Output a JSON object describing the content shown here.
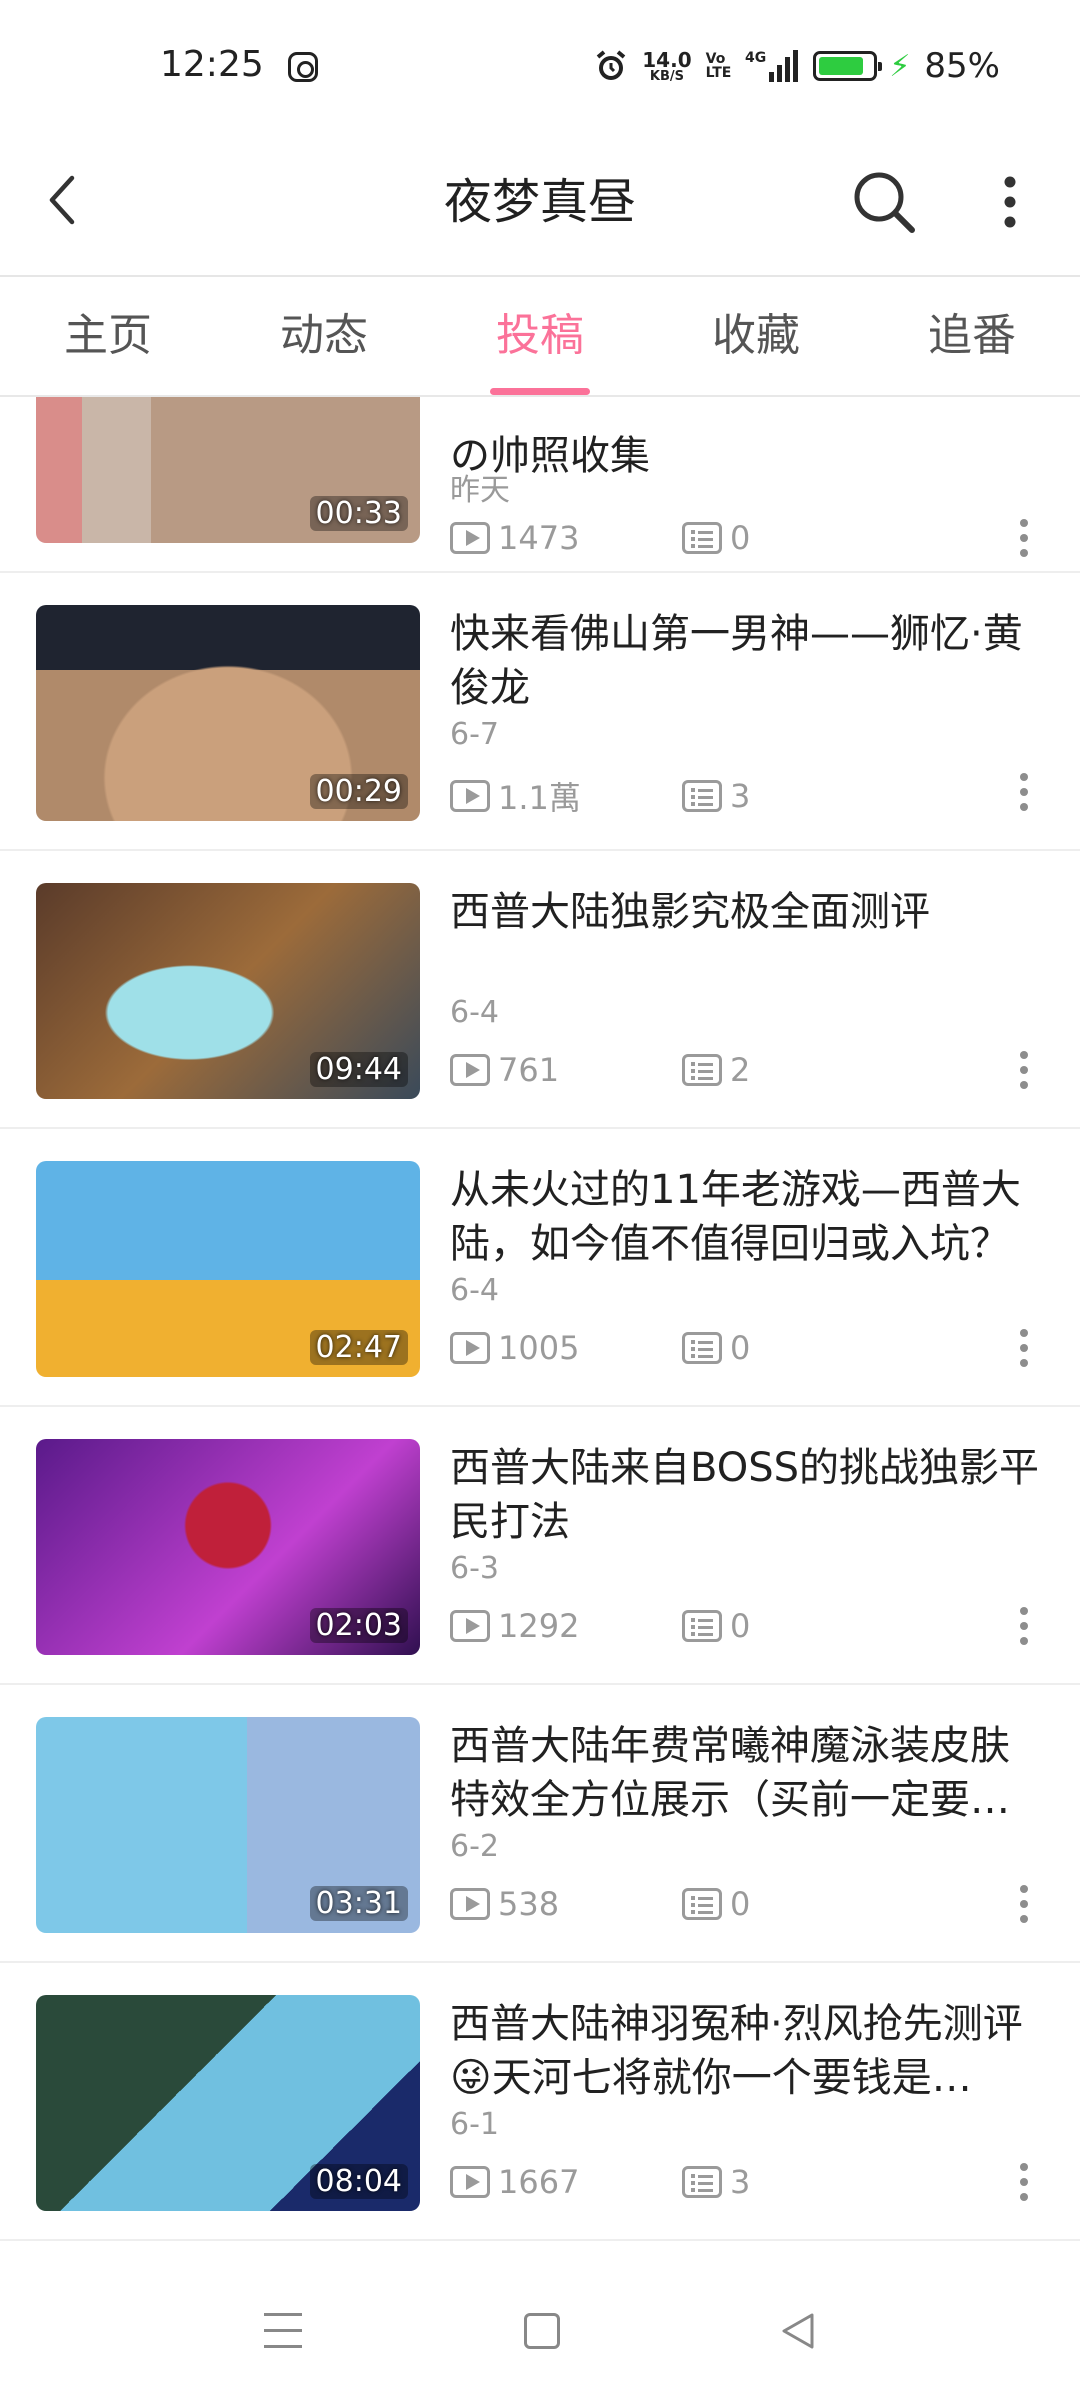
{
  "status_bar": {
    "time": "12:25",
    "net_speed_value": "14.0",
    "net_speed_unit": "KB/S",
    "volte_top": "Vo",
    "volte_bottom": "LTE",
    "network": "4G",
    "battery_level": 0.85,
    "battery_text": "85%",
    "battery_color": "#2ecc40"
  },
  "toolbar": {
    "title": "夜梦真昼"
  },
  "tabs": [
    {
      "label": "主页"
    },
    {
      "label": "动态"
    },
    {
      "label": "投稿",
      "active": true
    },
    {
      "label": "收藏"
    },
    {
      "label": "追番"
    }
  ],
  "accent_color": "#fb7299",
  "videos": [
    {
      "title": "の帅照收集",
      "date": "昨天",
      "views": "1473",
      "comments": "0",
      "duration": "00:33"
    },
    {
      "title": "快来看佛山第一男神——狮忆·黄俊龙",
      "date": "6-7",
      "views": "1.1萬",
      "comments": "3",
      "duration": "00:29"
    },
    {
      "title": "西普大陆独影究极全面测评",
      "date": "6-4",
      "views": "761",
      "comments": "2",
      "duration": "09:44"
    },
    {
      "title": "从未火过的11年老游戏—西普大陆，如今值不值得回归或入坑？",
      "date": "6-4",
      "views": "1005",
      "comments": "0",
      "duration": "02:47"
    },
    {
      "title": "西普大陆来自BOSS的挑战独影平民打法",
      "date": "6-3",
      "views": "1292",
      "comments": "0",
      "duration": "02:03"
    },
    {
      "title": "西普大陆年费常曦神魔泳装皮肤特效全方位展示（买前一定要…",
      "date": "6-2",
      "views": "538",
      "comments": "0",
      "duration": "03:31"
    },
    {
      "title": "西普大陆神羽冤种·烈风抢先测评😜天河七将就你一个要钱是…",
      "date": "6-1",
      "views": "1667",
      "comments": "3",
      "duration": "08:04"
    }
  ]
}
